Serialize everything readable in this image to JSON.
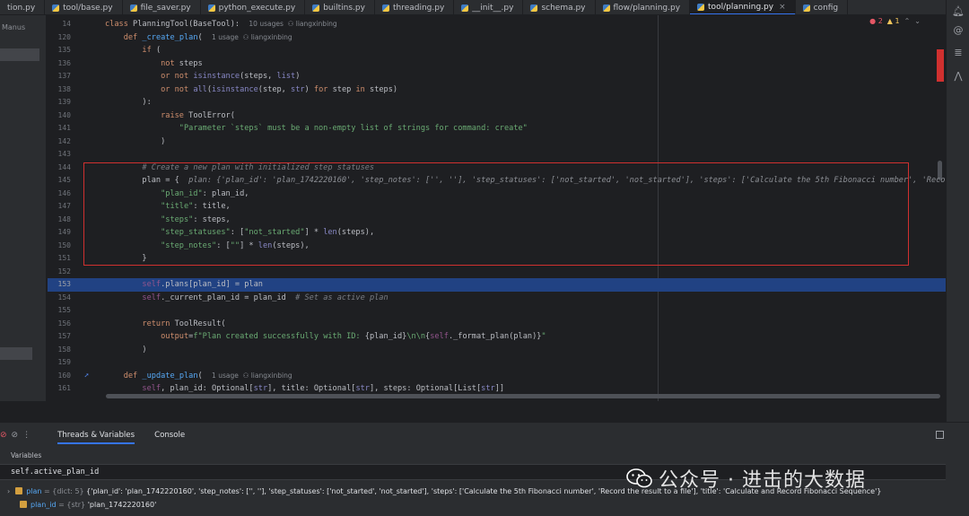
{
  "tabs": [
    {
      "label": "tion.py",
      "active": false
    },
    {
      "label": "tool/base.py",
      "active": false
    },
    {
      "label": "file_saver.py",
      "active": false
    },
    {
      "label": "python_execute.py",
      "active": false
    },
    {
      "label": "builtins.py",
      "active": false
    },
    {
      "label": "threading.py",
      "active": false
    },
    {
      "label": "__init__.py",
      "active": false
    },
    {
      "label": "schema.py",
      "active": false
    },
    {
      "label": "flow/planning.py",
      "active": false
    },
    {
      "label": "tool/planning.py",
      "active": true
    },
    {
      "label": "config",
      "active": false
    }
  ],
  "sidebar": {
    "project_label": "Manus"
  },
  "inspections": {
    "errors": "2",
    "warnings": "1"
  },
  "editor": {
    "lines": [
      {
        "n": "14",
        "html": "<span class=\"kw\">class</span> PlanningTool(BaseTool):  <span class=\"usage\">10 usages  ⚇ liangxinbing</span>"
      },
      {
        "n": "120",
        "html": "    <span class=\"kw\">def</span> <span class=\"fn\">_create_plan</span>(  <span class=\"usage\">1 usage  ⚇ liangxinbing</span>"
      },
      {
        "n": "135",
        "html": "        <span class=\"kw\">if</span> ("
      },
      {
        "n": "136",
        "html": "            <span class=\"kw\">not</span> steps"
      },
      {
        "n": "137",
        "html": "            <span class=\"kw\">or not</span> <span class=\"bi\">isinstance</span>(steps, <span class=\"bi\">list</span>)"
      },
      {
        "n": "138",
        "html": "            <span class=\"kw\">or not</span> <span class=\"bi\">all</span>(<span class=\"bi\">isinstance</span>(step, <span class=\"bi\">str</span>) <span class=\"kw\">for</span> step <span class=\"kw\">in</span> steps)"
      },
      {
        "n": "139",
        "html": "        ):"
      },
      {
        "n": "140",
        "html": "            <span class=\"kw\">raise</span> ToolError("
      },
      {
        "n": "141",
        "html": "                <span class=\"str\">\"Parameter `steps` must be a non-empty list of strings for command: create\"</span>"
      },
      {
        "n": "142",
        "html": "            )"
      },
      {
        "n": "143",
        "html": ""
      },
      {
        "n": "144",
        "html": "        <span class=\"cm\"># Create a new plan with initialized step statuses</span>"
      },
      {
        "n": "145",
        "html": "        plan = {  <span class=\"hint\">plan: {'plan_id': 'plan_1742220160', 'step_notes': ['', ''], 'step_statuses': ['not_started', 'not_started'], 'steps': ['Calculate the 5th Fibonacci number', 'Record</span>"
      },
      {
        "n": "146",
        "html": "            <span class=\"str\">\"plan_id\"</span>: plan_id,"
      },
      {
        "n": "147",
        "html": "            <span class=\"str\">\"title\"</span>: title,"
      },
      {
        "n": "148",
        "html": "            <span class=\"str\">\"steps\"</span>: steps,"
      },
      {
        "n": "149",
        "html": "            <span class=\"str\">\"step_statuses\"</span>: [<span class=\"str\">\"not_started\"</span>] * <span class=\"bi\">len</span>(steps),"
      },
      {
        "n": "150",
        "html": "            <span class=\"str\">\"step_notes\"</span>: [<span class=\"str\">\"\"</span>] * <span class=\"bi\">len</span>(steps),"
      },
      {
        "n": "151",
        "html": "        }"
      },
      {
        "n": "152",
        "html": ""
      },
      {
        "n": "153",
        "html": "        <span class=\"slf\">self</span>.plans[plan_id] = plan",
        "hl": true
      },
      {
        "n": "154",
        "html": "        <span class=\"slf\">self</span>._current_plan_id = plan_id  <span class=\"cm\"># Set as active plan</span>"
      },
      {
        "n": "155",
        "html": ""
      },
      {
        "n": "156",
        "html": "        <span class=\"kw\">return</span> ToolResult("
      },
      {
        "n": "157",
        "html": "            <span class=\"kw\">output</span>=<span class=\"str\">f\"Plan created successfully with ID: </span>{plan_id}<span class=\"str\">\\n\\n</span>{<span class=\"slf\">self</span>._format_plan(plan)}<span class=\"str\">\"</span>"
      },
      {
        "n": "158",
        "html": "        )"
      },
      {
        "n": "159",
        "html": ""
      },
      {
        "n": "160",
        "html": "    <span class=\"kw\">def</span> <span class=\"fn\">_update_plan</span>(  <span class=\"usage\">1 usage  ⚇ liangxinbing</span>"
      },
      {
        "n": "161",
        "html": "        <span class=\"slf\">self</span>, plan_id: Optional[<span class=\"bi\">str</span>], title: Optional[<span class=\"bi\">str</span>], steps: Optional[List[<span class=\"bi\">str</span>]]"
      }
    ]
  },
  "debug": {
    "tabs": [
      "Threads & Variables",
      "Console"
    ],
    "variables_header": "Variables",
    "eval_expression": "self.active_plan_id",
    "vars": [
      {
        "name": "plan",
        "type": "= {dict: 5}",
        "value": "{'plan_id': 'plan_1742220160', 'step_notes': ['', ''], 'step_statuses': ['not_started', 'not_started'], 'steps': ['Calculate the 5th Fibonacci number', 'Record the result to a file'], 'title': 'Calculate and Record Fibonacci Sequence'}"
      },
      {
        "name": "plan_id",
        "type": "= {str}",
        "value": "'plan_1742220160'"
      }
    ]
  },
  "watermark": {
    "text": "公众号 · 进击的大数据"
  }
}
